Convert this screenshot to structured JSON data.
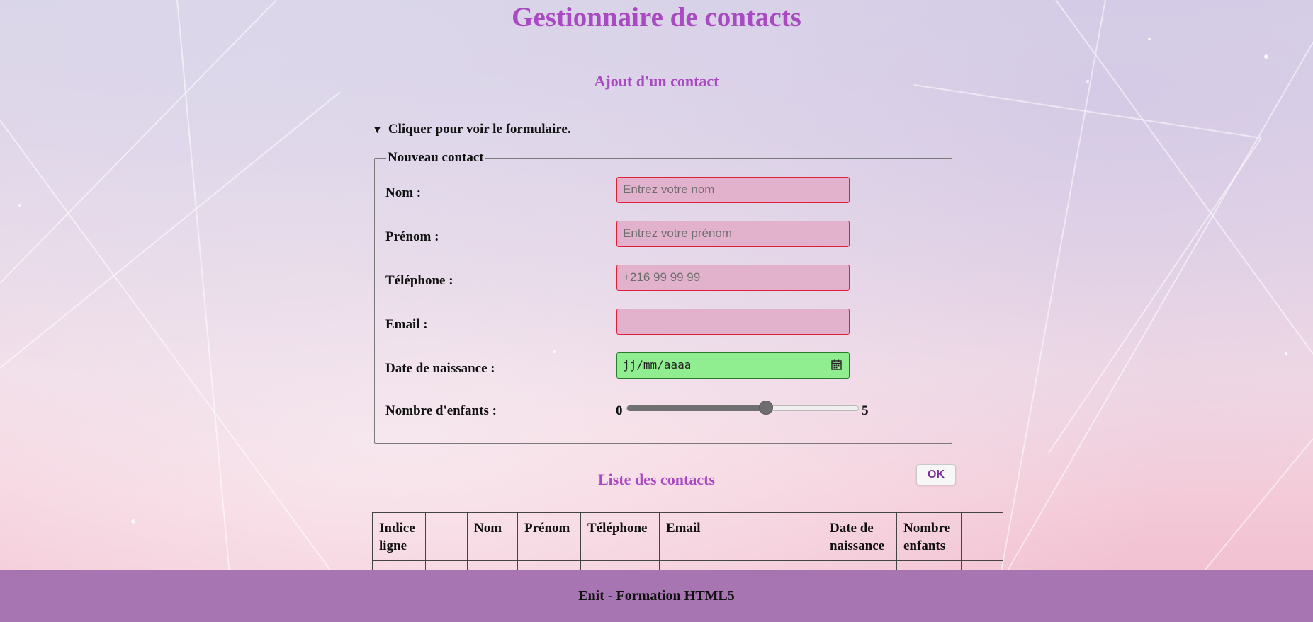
{
  "header": {
    "title": "Gestionnaire de contacts"
  },
  "form_section": {
    "title": "Ajout d'un contact",
    "details_summary": "Cliquer pour voir le formulaire.",
    "fieldset_legend": "Nouveau contact",
    "fields": {
      "nom": {
        "label": "Nom :",
        "value": "",
        "placeholder": "Entrez votre nom"
      },
      "prenom": {
        "label": "Prénom :",
        "value": "",
        "placeholder": "Entrez votre prénom"
      },
      "telephone": {
        "label": "Téléphone :",
        "value": "",
        "placeholder": "+216 99 99 99"
      },
      "email": {
        "label": "Email :",
        "value": "",
        "placeholder": ""
      },
      "date_naissance": {
        "label": "Date de naissance :",
        "value": "",
        "placeholder": "jj/mm/aaaa"
      },
      "nombre_enfants": {
        "label": "Nombre d'enfants :",
        "min": "0",
        "max": "5",
        "value": 3
      }
    },
    "ok_button": "OK"
  },
  "list_section": {
    "title": "Liste des contacts",
    "table": {
      "headers": [
        [
          "Indice",
          "ligne"
        ],
        [
          ""
        ],
        [
          "Nom"
        ],
        [
          "Prénom"
        ],
        [
          "Téléphone"
        ],
        [
          "Email"
        ],
        [
          "Date de",
          "naissance"
        ],
        [
          "Nombre",
          "enfants"
        ],
        [
          ""
        ]
      ]
    }
  },
  "footer": {
    "text": "Enit - Formation HTML5"
  },
  "colors": {
    "title": "#a94ac2",
    "required_border": "#e0203a",
    "input_bg": "#e2b2cc",
    "date_bg": "#90ee90",
    "footer_bg": "#a775b2"
  }
}
